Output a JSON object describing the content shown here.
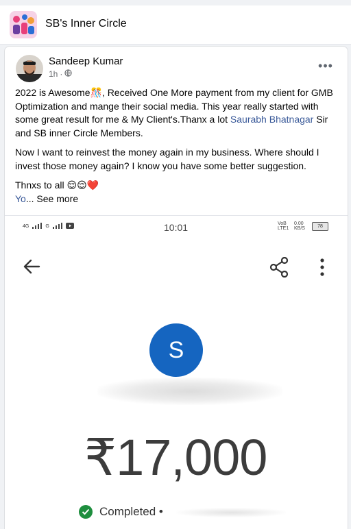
{
  "group": {
    "name": "SB's Inner Circle"
  },
  "post": {
    "author": "Sandeep Kumar",
    "time": "1h",
    "meta_separator": "·",
    "more_label": "•••",
    "paragraph1_a": "2022 is Awesome🎊, Received One More payment from my client for GMB Optimization and mange their social media. This year really started with some great result for me & My Client's.Thanx a lot ",
    "mention": "Saurabh Bhatnagar",
    "paragraph1_b": " Sir and SB inner Circle Members.",
    "paragraph2": "Now I want to reinvest the money again in my business. Where should I invest those money again? I know you have some better suggestion.",
    "paragraph3": "Thnxs to all 😌😌❤️",
    "truncated": "Yo",
    "see_more": "... See more"
  },
  "screenshot": {
    "status_bar": {
      "network1": "4G",
      "network2": "G",
      "time": "10:01",
      "volte": "VoB LTE1",
      "speed": "0.00 KB/S",
      "battery": "78"
    },
    "payee_initial": "S",
    "amount": "₹17,000",
    "status": "Completed •"
  },
  "colors": {
    "link": "#385898",
    "payee_avatar": "#1565c0",
    "success": "#1e8e3e"
  }
}
